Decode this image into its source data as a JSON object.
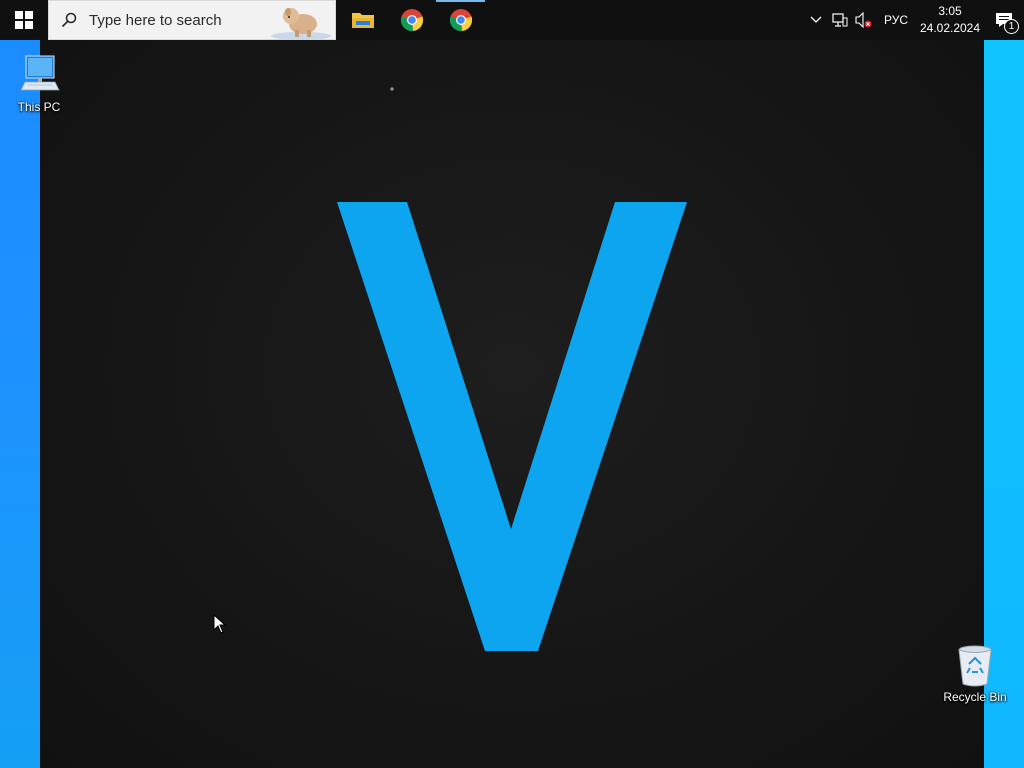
{
  "taskbar": {
    "start_icon": "windows-logo-icon",
    "search_placeholder": "Type here to search",
    "search_icon": "search-icon",
    "pinned_apps": [
      {
        "name": "File Explorer",
        "icon": "folder-icon",
        "active": false
      },
      {
        "name": "Google Chrome",
        "icon": "chrome-icon",
        "active": false
      },
      {
        "name": "Google Chrome",
        "icon": "chrome-icon",
        "active": true
      }
    ],
    "tray": {
      "language": "РУС",
      "time": "3:05",
      "date": "24.02.2024",
      "notification_count": "1"
    }
  },
  "desktop": {
    "icons": [
      {
        "label": "This PC",
        "icon": "computer-icon"
      },
      {
        "label": "Recycle Bin",
        "icon": "recycle-bin-icon"
      }
    ],
    "splash": {
      "logo_letter": "V"
    }
  },
  "colors": {
    "accent": "#0ea5f0",
    "taskbar": "#101010",
    "desktop_blue": "#1e90ff",
    "splash_bg": "#161616"
  }
}
